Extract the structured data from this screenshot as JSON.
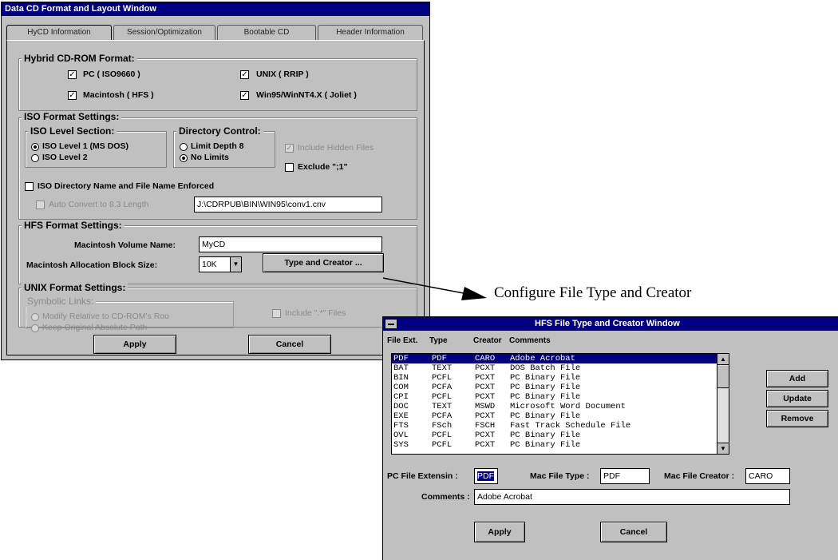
{
  "window1": {
    "title": "Data CD Format and Layout Window",
    "tabs": [
      "HyCD Information",
      "Session/Optimization",
      "Bootable CD",
      "Header Information"
    ],
    "hybrid": {
      "title": "Hybrid CD-ROM Format:",
      "pc": "PC ( ISO9660 )",
      "mac": "Macintosh ( HFS )",
      "unix": "UNIX ( RRIP )",
      "win": "Win95/WinNT4.X ( Joliet )"
    },
    "iso": {
      "title": "ISO Format Settings:",
      "level_title": "ISO Level Section:",
      "level1": "ISO Level 1 (MS DOS)",
      "level2": "ISO Level 2",
      "dir_title": "Directory Control:",
      "limit": "Limit Depth 8",
      "nolimit": "No Limits",
      "include_hidden": "Include Hidden Files",
      "exclude": "Exclude \";1\"",
      "enforced": "ISO Directory Name and File Name Enforced",
      "auto_convert": "Auto Convert to 8.3 Length",
      "path_value": "J:\\CDRPUB\\BIN\\WIN95\\conv1.cnv"
    },
    "hfs": {
      "title": "HFS Format Settings:",
      "volume_label": "Macintosh Volume Name:",
      "volume_value": "MyCD",
      "block_label": "Macintosh Allocation Block Size:",
      "block_value": "10K",
      "type_creator_button": "Type and Creator ..."
    },
    "unix": {
      "title": "UNIX Format Settings:",
      "symlinks_title": "Symbolic Links:",
      "modify": "Modify Relative to CD-ROM's Roo",
      "keep": "Keep Original Absolute Path",
      "include": "Include \".*\" Files"
    },
    "apply": "Apply",
    "cancel": "Cancel"
  },
  "caption": "Configure File Type and Creator",
  "window2": {
    "title": "HFS File Type and Creator Window",
    "columns": [
      "File Ext.",
      "Type",
      "Creator",
      "Comments"
    ],
    "rows": [
      [
        "PDF",
        "PDF",
        "CARO",
        "Adobe Acrobat"
      ],
      [
        "BAT",
        "TEXT",
        "PCXT",
        "DOS Batch File"
      ],
      [
        "BIN",
        "PCFL",
        "PCXT",
        "PC Binary File"
      ],
      [
        "COM",
        "PCFA",
        "PCXT",
        "PC Binary File"
      ],
      [
        "CPI",
        "PCFL",
        "PCXT",
        "PC Binary File"
      ],
      [
        "DOC",
        "TEXT",
        "MSWD",
        "Microsoft Word Document"
      ],
      [
        "EXE",
        "PCFA",
        "PCXT",
        "PC Binary File"
      ],
      [
        "FTS",
        "FSch",
        "FSCH",
        "Fast Track Schedule File"
      ],
      [
        "OVL",
        "PCFL",
        "PCXT",
        "PC Binary File"
      ],
      [
        "SYS",
        "PCFL",
        "PCXT",
        "PC Binary File"
      ]
    ],
    "buttons": {
      "add": "Add",
      "update": "Update",
      "remove": "Remove"
    },
    "ext_label": "PC File Extensin :",
    "ext_value": "PDF",
    "type_label": "Mac File Type :",
    "type_value": "PDF",
    "creator_label": "Mac File Creator :",
    "creator_value": "CARO",
    "comments_label": "Comments :",
    "comments_value": "Adobe Acrobat",
    "apply": "Apply",
    "cancel": "Cancel"
  }
}
